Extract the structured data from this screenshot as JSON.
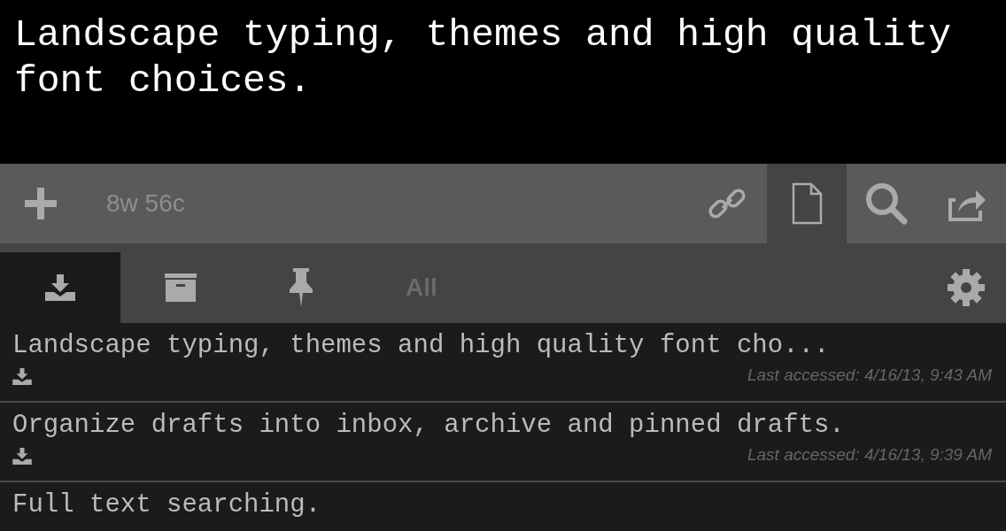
{
  "header": {
    "text": "Landscape typing, themes and high quality font choices."
  },
  "toolbar": {
    "word_count": "8w 56c",
    "buttons": [
      {
        "kind": "link",
        "selected": false
      },
      {
        "kind": "document",
        "selected": true
      },
      {
        "kind": "search",
        "selected": false
      },
      {
        "kind": "share",
        "selected": false
      }
    ]
  },
  "tabs": [
    {
      "kind": "inbox",
      "selected": true
    },
    {
      "kind": "archive",
      "selected": false
    },
    {
      "kind": "pinned",
      "selected": false
    },
    {
      "kind": "text",
      "label": "All",
      "selected": false
    }
  ],
  "drafts": [
    {
      "text": "Landscape typing, themes and high quality font cho...",
      "kind": "inbox",
      "last_accessed": "Last accessed: 4/16/13, 9:43 AM"
    },
    {
      "text": "Organize drafts into inbox, archive and pinned drafts.",
      "kind": "inbox",
      "last_accessed": "Last accessed: 4/16/13, 9:39 AM"
    },
    {
      "text": "Full text searching."
    }
  ]
}
